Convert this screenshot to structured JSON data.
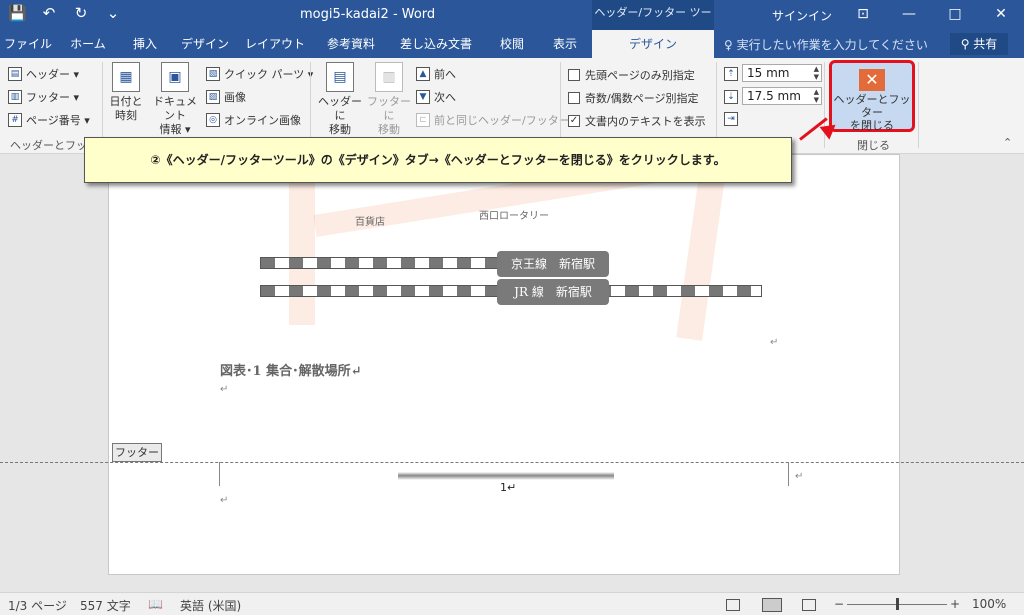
{
  "titlebar": {
    "title": "mogi5-kadai2  -  Word",
    "context_tool": "ヘッダー/フッター ツール",
    "signin": "サインイン",
    "qat": {
      "save": "💾",
      "undo": "↶",
      "redo": "↻",
      "customize": "⌄"
    },
    "controls": {
      "ribbon_options": "⊡",
      "minimize": "—",
      "maximize": "□",
      "close": "✕"
    }
  },
  "tabs": [
    "ファイル",
    "ホーム",
    "挿入",
    "デザイン",
    "レイアウト",
    "参考資料",
    "差し込み文書",
    "校閲",
    "表示",
    "デザイン"
  ],
  "tell_me": "♀ 実行したい作業を入力してください",
  "share": "⚲ 共有",
  "ribbon": {
    "header": "ヘッダー ▾",
    "footer": "フッター ▾",
    "page_number": "ページ番号 ▾",
    "group_hf": "ヘッダーとフッター",
    "date_time": [
      "日付と",
      "時刻"
    ],
    "doc_info": [
      "ドキュメント",
      "情報 ▾"
    ],
    "quick_parts": "クイック パーツ ▾",
    "picture": "画像",
    "online_picture": "オンライン画像",
    "goto_header": [
      "ヘッダーに",
      "移動"
    ],
    "goto_footer": [
      "フッターに",
      "移動"
    ],
    "previous": "前へ",
    "next": "次へ",
    "link_previous": "前と同じヘッダー/フッター",
    "first_page_diff": "先頭ページのみ別指定",
    "odd_even_diff": "奇数/偶数ページ別指定",
    "show_doc_text": "文書内のテキストを表示",
    "show_doc_text_checked": "✓",
    "header_from_top": "15 mm",
    "footer_from_bottom": "17.5 mm",
    "close_hf": [
      "ヘッダーとフッター",
      "を閉じる"
    ],
    "close_group": "閉じる",
    "collapse": "⌃"
  },
  "callout": "②《ヘッダー/フッターツール》の《デザイン》タブ→《ヘッダーとフッターを閉じる》をクリックします。",
  "document": {
    "map_labels": {
      "store": "百貨店",
      "rotary": "西口ロータリー"
    },
    "stations": [
      "京王線　新宿駅",
      "JR 線　新宿駅"
    ],
    "figure_caption": "図表･1 集合･解散場所↵",
    "para_mark": "↵",
    "footer_tag": "フッター",
    "page_number": "1↵"
  },
  "statusbar": {
    "pages": "1/3 ページ",
    "words": "557 文字",
    "proof_icon": "📖",
    "language": "英語 (米国)",
    "zoom_minus": "−",
    "zoom_plus": "+",
    "zoom": "100%",
    "zoom_fraction": 0.5
  }
}
